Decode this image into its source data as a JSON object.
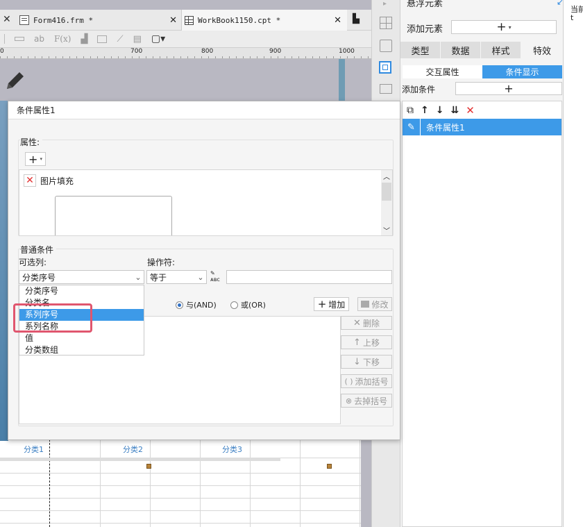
{
  "tabs": [
    {
      "label": "Form416.frm *",
      "icon": "form-file-icon"
    },
    {
      "label": "WorkBook1150.cpt *",
      "icon": "workbook-file-icon"
    }
  ],
  "toolbar": {
    "items": [
      "ab",
      "F(x)"
    ]
  },
  "ruler": {
    "ticks": [
      "0",
      "700",
      "800",
      "900",
      "1000"
    ]
  },
  "sheet": {
    "categories": [
      "分类1",
      "分类2",
      "分类3"
    ]
  },
  "right_panel": {
    "title": "悬浮元素",
    "add_element_label": "添加元素",
    "tabs": [
      "类型",
      "数据",
      "样式",
      "特效"
    ],
    "subtabs": [
      "交互属性",
      "条件显示"
    ],
    "add_condition_label": "添加条件",
    "condition_items": [
      "条件属性1"
    ],
    "edge_text": "当前\nt"
  },
  "dialog": {
    "title": "条件属性1",
    "property_label": "属性:",
    "property_item": "图片填充",
    "common_condition_label": "普通条件",
    "optional_column_label": "可选列:",
    "column_selected": "分类序号",
    "operator_label": "操作符:",
    "operator_selected": "等于",
    "value_input": "",
    "dropdown_options": [
      "分类序号",
      "分类名",
      "系列序号",
      "系列名称",
      "值",
      "分类数组"
    ],
    "highlighted_option": "系列序号",
    "radio_and": "与(AND)",
    "radio_or": "或(OR)",
    "add_button": "增加",
    "modify_button": "修改",
    "delete_button": "删除",
    "move_up_button": "上移",
    "move_down_button": "下移",
    "add_bracket_button": "添加括号",
    "remove_bracket_button": "去掉括号"
  },
  "colors": {
    "accent": "#3d9ae8",
    "highlight_frame": "#e0566e",
    "delete_red": "#e23030"
  }
}
